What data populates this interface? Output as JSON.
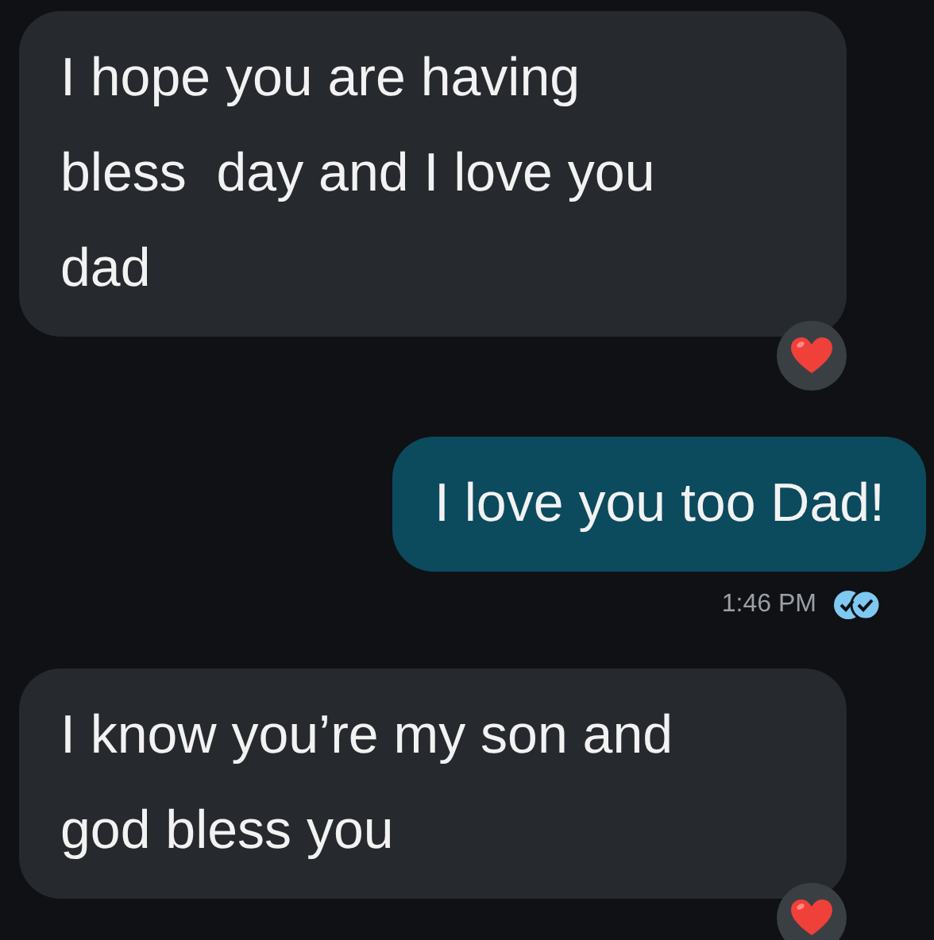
{
  "messages": [
    {
      "kind": "incoming",
      "text": "I hope you are having\nbless  day and I love you\ndad",
      "reacted": true
    },
    {
      "kind": "outgoing",
      "text": "I love you too Dad!",
      "time": "1:46 PM",
      "read": true
    },
    {
      "kind": "incoming",
      "text": "I know you’re my son and\ngod bless you",
      "reacted": true
    }
  ]
}
